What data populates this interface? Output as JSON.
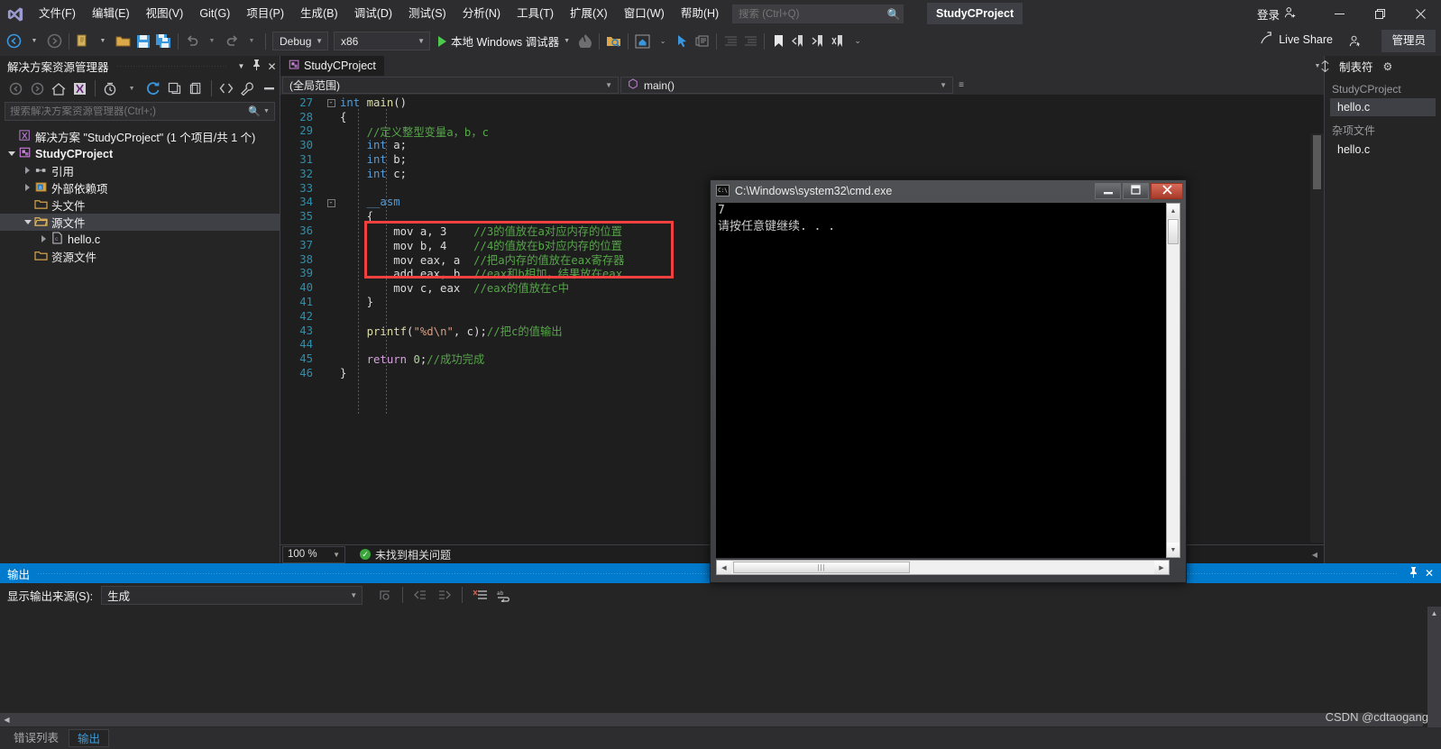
{
  "titlebar": {
    "menus": [
      {
        "label": "文件(F)"
      },
      {
        "label": "编辑(E)"
      },
      {
        "label": "视图(V)"
      },
      {
        "label": "Git(G)"
      },
      {
        "label": "项目(P)"
      },
      {
        "label": "生成(B)"
      },
      {
        "label": "调试(D)"
      },
      {
        "label": "测试(S)"
      },
      {
        "label": "分析(N)"
      },
      {
        "label": "工具(T)"
      },
      {
        "label": "扩展(X)"
      },
      {
        "label": "窗口(W)"
      },
      {
        "label": "帮助(H)"
      }
    ],
    "search_placeholder": "搜索 (Ctrl+Q)",
    "project_title": "StudyCProject",
    "signin_label": "登录",
    "minimize": "—",
    "restore": "❐",
    "close": "✕"
  },
  "toolbar": {
    "config": "Debug",
    "platform": "x86",
    "run_label": "本地 Windows 调试器",
    "live_share": "Live Share",
    "admin": "管理员"
  },
  "solution_explorer": {
    "title": "解决方案资源管理器",
    "search_placeholder": "搜索解决方案资源管理器(Ctrl+;)",
    "tree": [
      {
        "label": "解决方案 \"StudyCProject\" (1 个项目/共 1 个)",
        "icon": "solution-icon",
        "indent": 0,
        "arrow": "none",
        "bold": false,
        "selected": false
      },
      {
        "label": "StudyCProject",
        "icon": "project-icon",
        "indent": 1,
        "arrow": "open",
        "bold": true,
        "selected": false
      },
      {
        "label": "引用",
        "icon": "references-icon",
        "indent": 2,
        "arrow": "closed",
        "bold": false,
        "selected": false
      },
      {
        "label": "外部依赖项",
        "icon": "external-deps-icon",
        "indent": 2,
        "arrow": "closed",
        "bold": false,
        "selected": false
      },
      {
        "label": "头文件",
        "icon": "folder-icon",
        "indent": 2,
        "arrow": "none",
        "bold": false,
        "selected": false
      },
      {
        "label": "源文件",
        "icon": "folder-open-icon",
        "indent": 2,
        "arrow": "open",
        "bold": false,
        "selected": true
      },
      {
        "label": "hello.c",
        "icon": "c-file-icon",
        "indent": 3,
        "arrow": "closed",
        "bold": false,
        "selected": false
      },
      {
        "label": "资源文件",
        "icon": "folder-icon",
        "indent": 2,
        "arrow": "none",
        "bold": false,
        "selected": false
      }
    ]
  },
  "editor": {
    "tab_label": "StudyCProject",
    "scope_combo": "(全局范围)",
    "member_combo": "main()",
    "zoom": "100 %",
    "status": "未找到相关问题",
    "lines": [
      {
        "n": "27",
        "fold": "-",
        "modified": true,
        "html": "<span class=\"k\">int</span> <span class=\"fn\">main</span><span class=\"pl\">()</span>"
      },
      {
        "n": "28",
        "fold": "",
        "modified": true,
        "html": "<span class=\"pl\">{</span>"
      },
      {
        "n": "29",
        "fold": "",
        "modified": true,
        "html": "    <span class=\"cmt\">//定义整型变量a，b，c</span>"
      },
      {
        "n": "30",
        "fold": "",
        "modified": true,
        "html": "    <span class=\"k\">int</span> <span class=\"pl\">a;</span>"
      },
      {
        "n": "31",
        "fold": "",
        "modified": true,
        "html": "    <span class=\"k\">int</span> <span class=\"pl\">b;</span>"
      },
      {
        "n": "32",
        "fold": "",
        "modified": true,
        "html": "    <span class=\"k\">int</span> <span class=\"pl\">c;</span>"
      },
      {
        "n": "33",
        "fold": "",
        "modified": true,
        "html": ""
      },
      {
        "n": "34",
        "fold": "-",
        "modified": true,
        "html": "    <span class=\"asmkw\">__asm</span>"
      },
      {
        "n": "35",
        "fold": "",
        "modified": true,
        "html": "    <span class=\"pl\">{</span>"
      },
      {
        "n": "36",
        "fold": "",
        "modified": true,
        "html": "        <span class=\"pl\">mov a, 3</span>    <span class=\"cmt\">//3的值放在a对应内存的位置</span>"
      },
      {
        "n": "37",
        "fold": "",
        "modified": true,
        "html": "        <span class=\"pl\">mov b, 4</span>    <span class=\"cmt\">//4的值放在b对应内存的位置</span>"
      },
      {
        "n": "38",
        "fold": "",
        "modified": true,
        "html": "        <span class=\"pl\">mov eax, a</span>  <span class=\"cmt\">//把a内存的值放在eax寄存器</span>"
      },
      {
        "n": "39",
        "fold": "",
        "modified": true,
        "html": "        <span class=\"pl\">add eax, b</span>  <span class=\"cmt\">//eax和b相加，结果放在eax</span>"
      },
      {
        "n": "40",
        "fold": "",
        "modified": true,
        "html": "        <span class=\"pl\">mov c, eax</span>  <span class=\"cmt\">//eax的值放在c中</span>"
      },
      {
        "n": "41",
        "fold": "",
        "modified": true,
        "html": "    <span class=\"pl\">}</span>"
      },
      {
        "n": "42",
        "fold": "",
        "modified": false,
        "html": ""
      },
      {
        "n": "43",
        "fold": "",
        "modified": false,
        "html": "    <span class=\"fn\">printf</span><span class=\"pl\">(</span><span class=\"str\">\"%d\\n\"</span><span class=\"pl\">, c);</span><span class=\"cmt\">//把c的值输出</span>"
      },
      {
        "n": "44",
        "fold": "",
        "modified": false,
        "html": ""
      },
      {
        "n": "45",
        "fold": "",
        "modified": false,
        "html": "    <span class=\"kw2\">return</span> <span class=\"num\">0</span><span class=\"pl\">;</span><span class=\"cmt\">//成功完成</span>"
      },
      {
        "n": "46",
        "fold": "",
        "modified": false,
        "html": "<span class=\"pl\">}</span>"
      }
    ]
  },
  "right_panel": {
    "title": "制表符",
    "groups": [
      {
        "name": "StudyCProject",
        "items": [
          {
            "label": "hello.c",
            "selected": true
          }
        ]
      },
      {
        "name": "杂项文件",
        "items": [
          {
            "label": "hello.c",
            "selected": false
          }
        ]
      }
    ]
  },
  "output_panel": {
    "title": "输出",
    "source_label": "显示输出来源(S):",
    "source_value": "生成",
    "body_text": "",
    "tabs": [
      {
        "label": "错误列表",
        "active": false
      },
      {
        "label": "输出",
        "active": true
      }
    ]
  },
  "cmd_window": {
    "title": "C:\\Windows\\system32\\cmd.exe",
    "line1": "7",
    "line2": "请按任意键继续. . .",
    "minimize": "—",
    "maximize": "❐",
    "close": "✕"
  },
  "watermark": "CSDN @cdtaogang",
  "colors": {
    "accent_blue": "#007acc",
    "bg_chrome": "#2d2d30",
    "bg_panel": "#252526",
    "bg_editor": "#1e1e1e",
    "highlight_box": "#f04040",
    "comment_green": "#57a64a",
    "keyword_blue": "#569cd6"
  }
}
